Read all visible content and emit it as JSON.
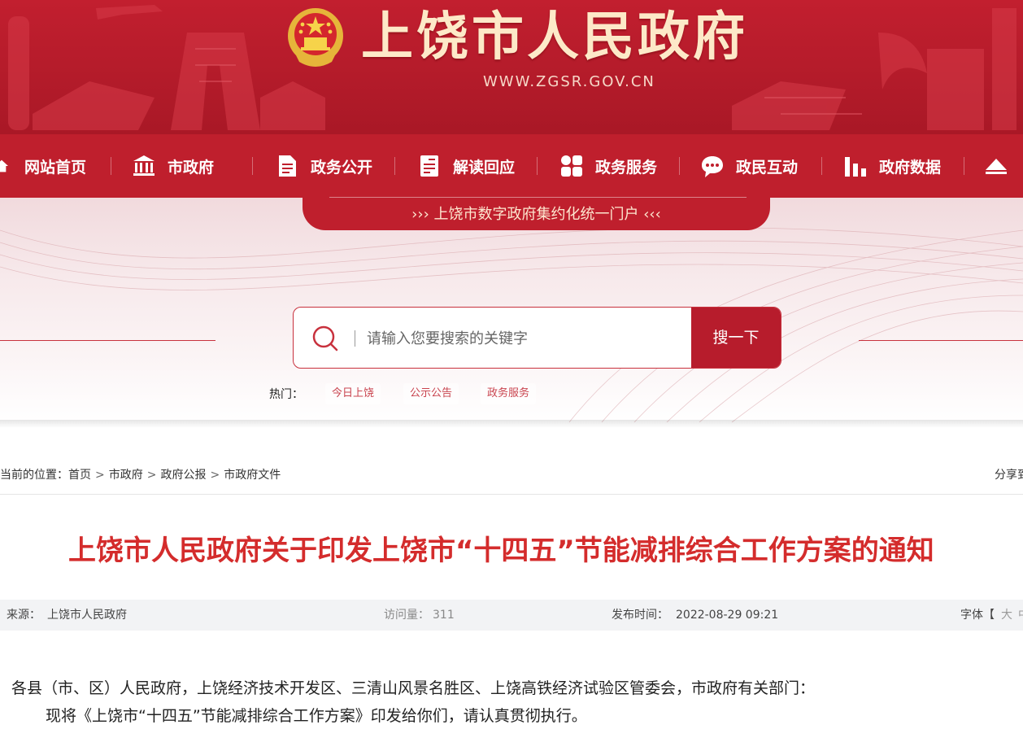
{
  "header": {
    "site_title": "上饶市人民政府",
    "site_url": "WWW.ZGSR.GOV.CN"
  },
  "nav": {
    "items": [
      {
        "label": "网站首页",
        "icon": "home-icon"
      },
      {
        "label": "市政府",
        "icon": "government-building-icon"
      },
      {
        "label": "政务公开",
        "icon": "document-icon"
      },
      {
        "label": "解读回应",
        "icon": "clipboard-icon"
      },
      {
        "label": "政务服务",
        "icon": "grid-apps-icon"
      },
      {
        "label": "政民互动",
        "icon": "chat-bubble-icon"
      },
      {
        "label": "政府数据",
        "icon": "bar-chart-icon"
      }
    ],
    "portal_text": "››› 上饶市数字政府集约化统一门户 ‹‹‹"
  },
  "search": {
    "placeholder": "请输入您要搜索的关键字",
    "button_label": "搜一下",
    "hot_label": "热门：",
    "hot_tags": [
      "今日上饶",
      "公示公告",
      "政务服务"
    ]
  },
  "breadcrumb": {
    "prefix": "您当前的位置：",
    "items": [
      "首页",
      "市政府",
      "政府公报",
      "市政府文件"
    ],
    "separator": ">",
    "share_label": "分享到"
  },
  "article": {
    "title": "上饶市人民政府关于印发上饶市“十四五”节能减排综合工作方案的通知",
    "source_label": "来源：",
    "source": "上饶市人民政府",
    "views_label": "访问量：",
    "views": "311",
    "date_label": "发布时间：",
    "date": "2022-08-29 09:21",
    "font_size_label": "字体【",
    "font_large": "大",
    "font_medium": "中",
    "paragraphs": [
      "各县（市、区）人民政府，上饶经济技术开发区、三清山风景名胜区、上饶高铁经济试验区管委会，市政府有关部门：",
      "现将《上饶市“十四五”节能减排综合工作方案》印发给你们，请认真贯彻执行。"
    ]
  },
  "colors": {
    "brand_red": "#bf1f2d",
    "title_red": "#d42c2c",
    "title_gold": "#fde9c8"
  }
}
